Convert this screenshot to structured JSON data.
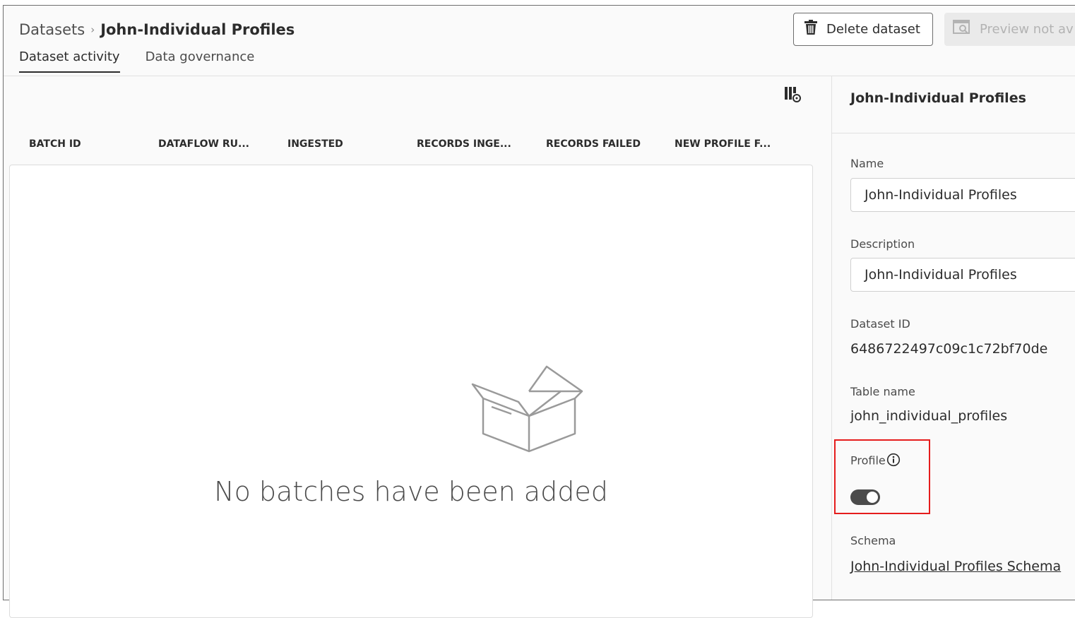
{
  "breadcrumb": {
    "root": "Datasets",
    "separator": "›",
    "current": "John-Individual Profiles"
  },
  "tabs": [
    {
      "label": "Dataset activity",
      "active": true
    },
    {
      "label": "Data governance",
      "active": false
    }
  ],
  "actions": {
    "delete_label": "Delete dataset",
    "delete_icon": "trash-icon",
    "preview_label": "Preview not av",
    "preview_icon": "preview-icon"
  },
  "table": {
    "columns": [
      "BATCH ID",
      "DATAFLOW RU...",
      "INGESTED",
      "RECORDS INGE...",
      "RECORDS FAILED",
      "NEW PROFILE F..."
    ],
    "empty_message": "No batches have been added",
    "empty_icon": "open-box-icon",
    "settings_icon": "column-settings-icon"
  },
  "panel": {
    "title": "John-Individual Profiles",
    "name_label": "Name",
    "name_value": "John-Individual Profiles",
    "description_label": "Description",
    "description_value": "John-Individual Profiles",
    "dataset_id_label": "Dataset ID",
    "dataset_id_value": "6486722497c09c1c72bf70de",
    "table_name_label": "Table name",
    "table_name_value": "john_individual_profiles",
    "profile_label": "Profile",
    "profile_enabled": true,
    "schema_label": "Schema",
    "schema_link": "John-Individual Profiles Schema"
  },
  "colors": {
    "highlight": "#e51d1d",
    "toggle_on": "#4b4b4b"
  }
}
